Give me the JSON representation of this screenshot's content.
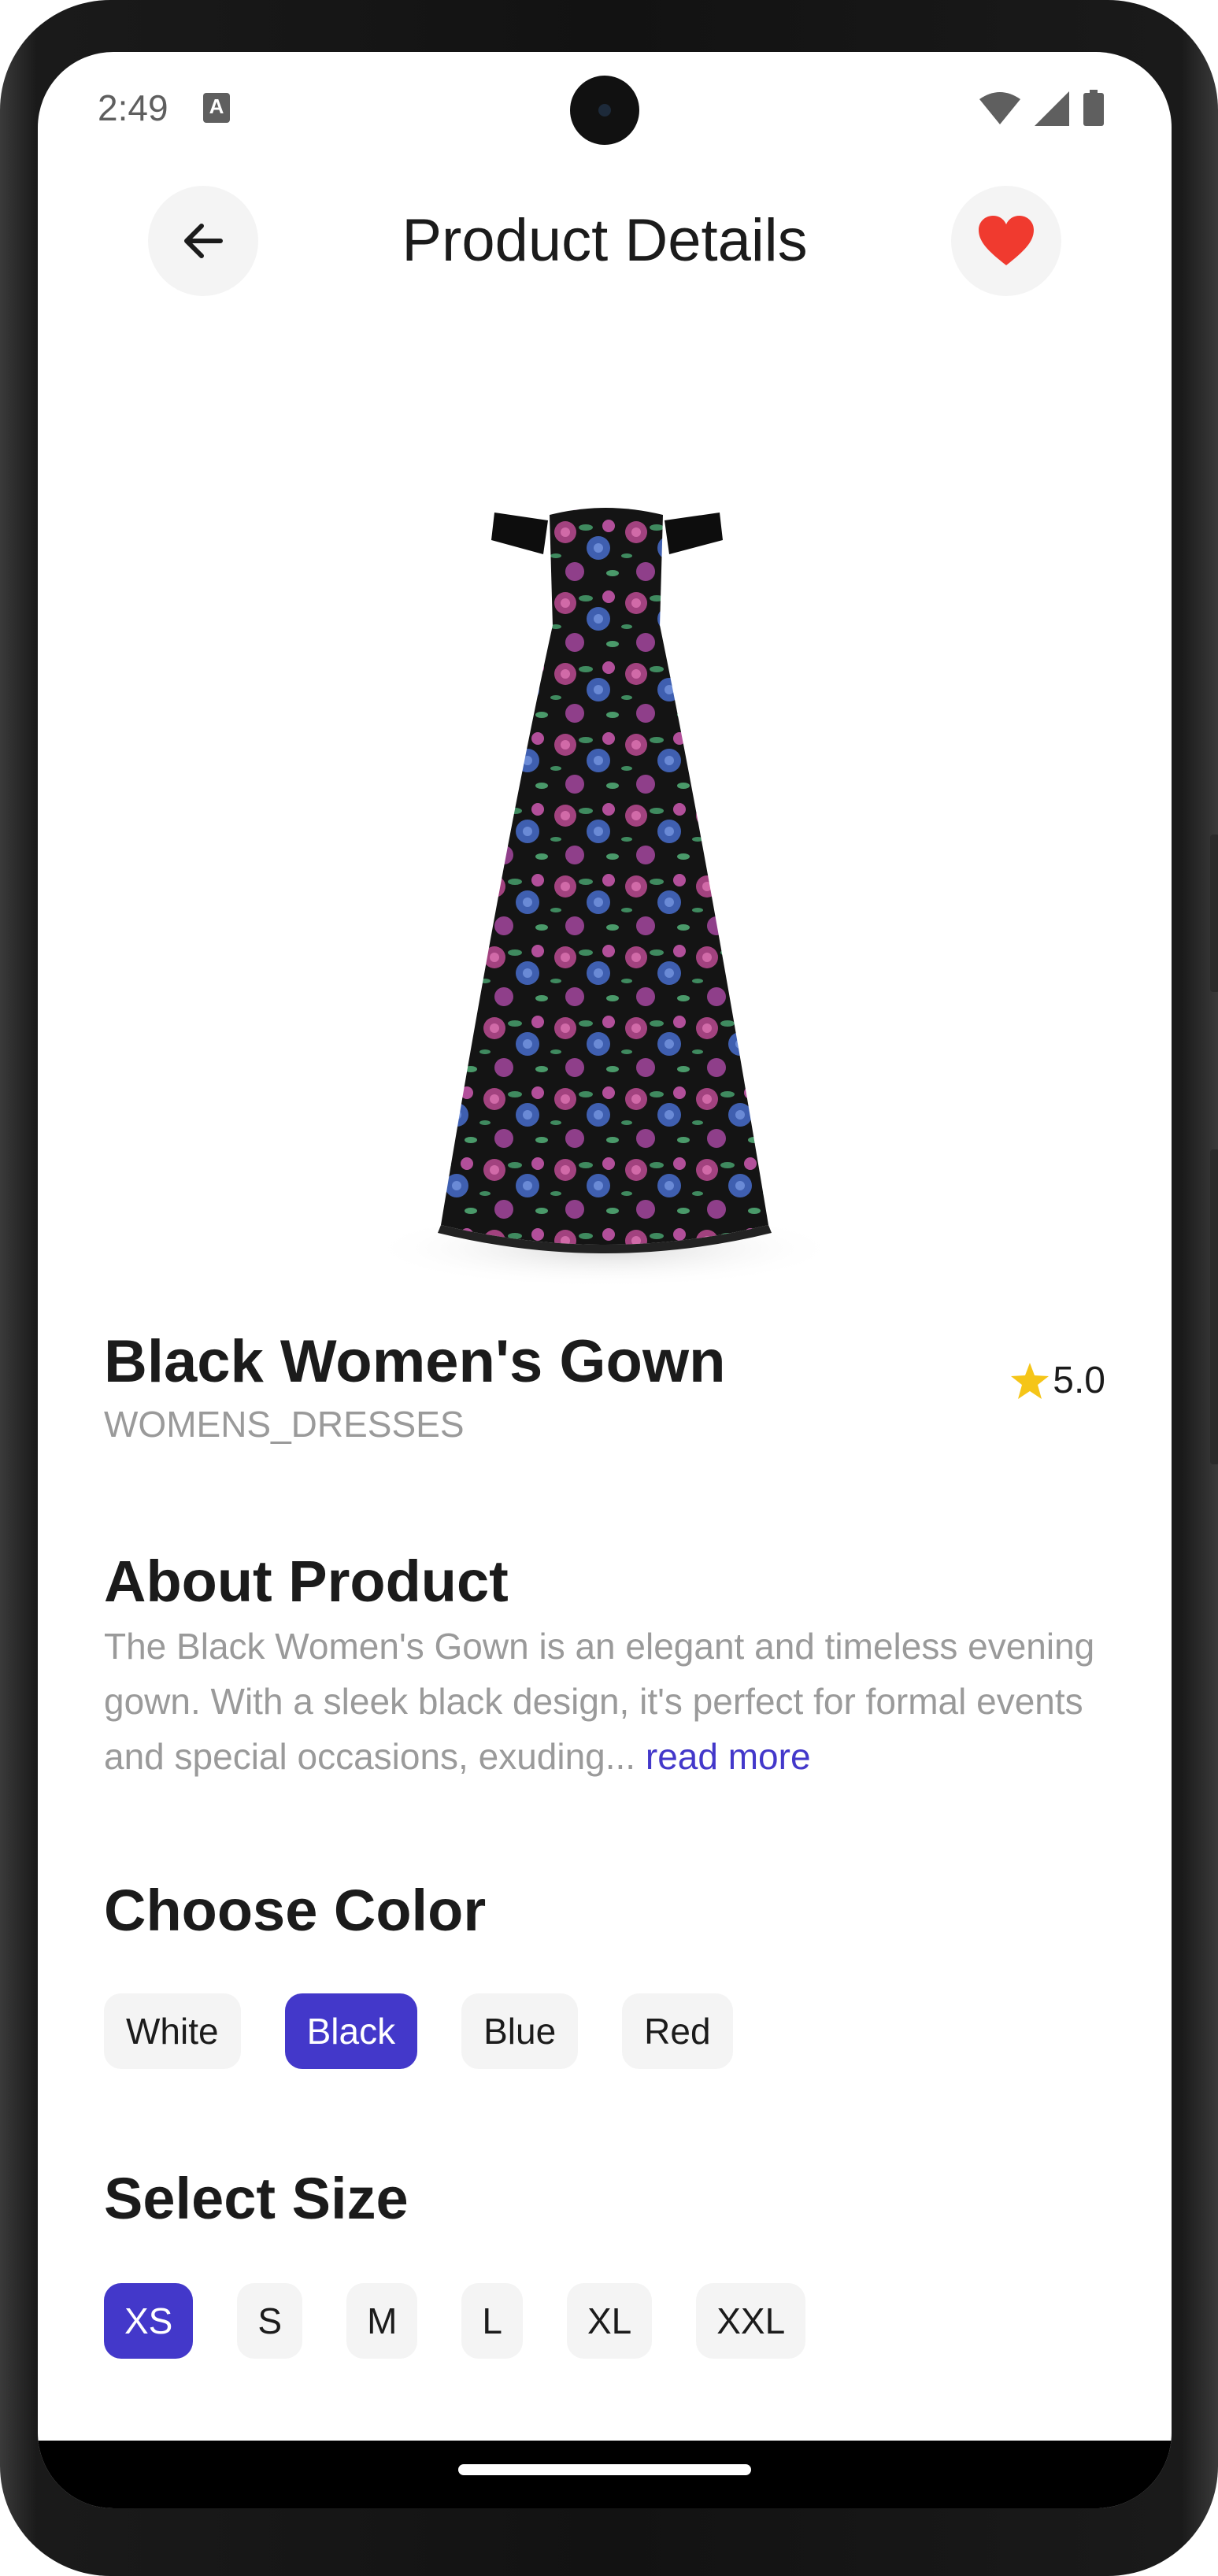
{
  "status_bar": {
    "time": "2:49",
    "notification_icon_letter": "A"
  },
  "header": {
    "title": "Product Details",
    "back_icon": "arrow-left-icon",
    "favorite_icon": "heart-icon",
    "favorite_color": "#f03a2f"
  },
  "product": {
    "name": "Black Women's Gown",
    "category": "WOMENS_DRESSES",
    "rating": "5.0",
    "rating_star_color": "#f5c518"
  },
  "about": {
    "title": "About Product",
    "text": "The Black Women's Gown is an elegant and timeless evening gown. With a sleek black design, it's perfect for formal events and special occasions, exuding...",
    "read_more": "read more"
  },
  "color": {
    "title": "Choose Color",
    "options": [
      "White",
      "Black",
      "Blue",
      "Red"
    ],
    "selected": "Black"
  },
  "size": {
    "title": "Select Size",
    "options": [
      "XS",
      "S",
      "M",
      "L",
      "XL",
      "XXL"
    ],
    "selected": "XS"
  },
  "theme": {
    "accent": "#4338ca",
    "chip_bg": "#f4f4f4",
    "muted_text": "#9a9a9a"
  }
}
